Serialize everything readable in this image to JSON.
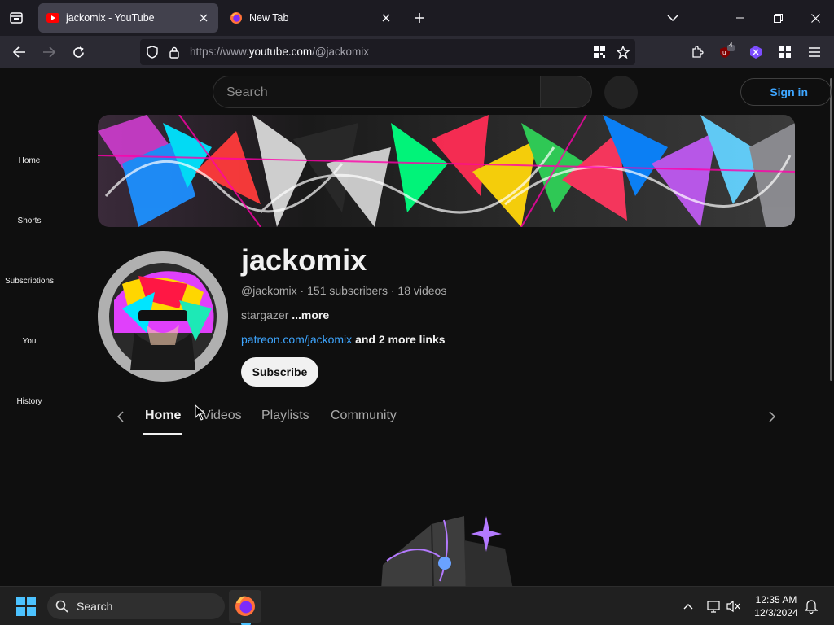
{
  "browser": {
    "tabs": [
      {
        "title": "jackomix - YouTube",
        "active": true,
        "favicon": "youtube-icon"
      },
      {
        "title": "New Tab",
        "active": false,
        "favicon": "firefox-icon"
      }
    ],
    "url_prefix": "https://www.",
    "url_host": "youtube.com",
    "url_path": "/@jackomix",
    "extension_badge": "4"
  },
  "youtube": {
    "search_placeholder": "Search",
    "signin_label": "Sign in",
    "sidebar": [
      {
        "label": "Home"
      },
      {
        "label": "Shorts"
      },
      {
        "label": "Subscriptions"
      },
      {
        "label": "You"
      },
      {
        "label": "History"
      }
    ],
    "channel": {
      "name": "jackomix",
      "handle": "@jackomix",
      "meta_sep": " · ",
      "subscribers": "151 subscribers",
      "videos": "18 videos",
      "description": "stargazer",
      "more_label": "...more",
      "link": "patreon.com/jackomix",
      "more_links": "and 2 more links",
      "subscribe_label": "Subscribe"
    },
    "tabs": [
      {
        "label": "Home",
        "active": true
      },
      {
        "label": "Videos",
        "active": false
      },
      {
        "label": "Playlists",
        "active": false
      },
      {
        "label": "Community",
        "active": false
      }
    ]
  },
  "taskbar": {
    "search_label": "Search",
    "time": "12:35 AM",
    "date": "12/3/2024"
  },
  "colors": {
    "link": "#3ea6ff",
    "page_bg": "#0f0f0f",
    "tab_active_bg": "#42414d"
  }
}
